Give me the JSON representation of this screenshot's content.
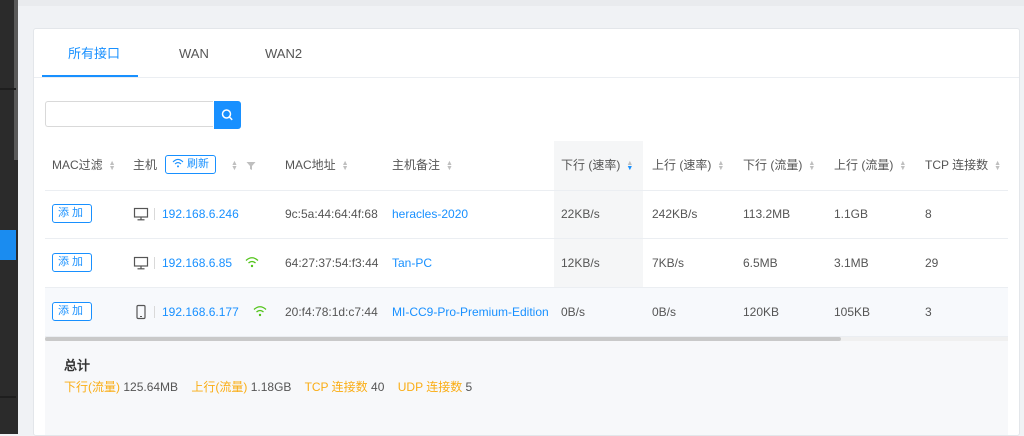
{
  "tabs": [
    {
      "label": "所有接口",
      "active": true
    },
    {
      "label": "WAN",
      "active": false
    },
    {
      "label": "WAN2",
      "active": false
    }
  ],
  "search": {
    "placeholder": "",
    "value": ""
  },
  "table": {
    "headers": {
      "mac_filter": "MAC过滤",
      "host": "主机",
      "refresh": "刷新",
      "mac": "MAC地址",
      "host_note": "主机备注",
      "down_rate": "下行 (速率)",
      "up_rate": "上行 (速率)",
      "down_traffic": "下行 (流量)",
      "up_traffic": "上行 (流量)",
      "tcp": "TCP 连接数"
    },
    "add_label": "添加",
    "rows": [
      {
        "device": "desktop-icon",
        "ip": "192.168.6.246",
        "wifi": false,
        "mac": "9c:5a:44:64:4f:68",
        "note": "heracles-2020",
        "down_rate": "22KB/s",
        "up_rate": "242KB/s",
        "down_traffic": "113.2MB",
        "up_traffic": "1.1GB",
        "tcp": "8"
      },
      {
        "device": "desktop-icon",
        "ip": "192.168.6.85",
        "wifi": true,
        "mac": "64:27:37:54:f3:44",
        "note": "Tan-PC",
        "down_rate": "12KB/s",
        "up_rate": "7KB/s",
        "down_traffic": "6.5MB",
        "up_traffic": "3.1MB",
        "tcp": "29"
      },
      {
        "device": "phone-icon",
        "ip": "192.168.6.177",
        "wifi": true,
        "mac": "20:f4:78:1d:c7:44",
        "note": "MI-CC9-Pro-Premium-Edition",
        "down_rate": "0B/s",
        "up_rate": "0B/s",
        "down_traffic": "120KB",
        "up_traffic": "105KB",
        "tcp": "3"
      }
    ]
  },
  "summary": {
    "title": "总计",
    "down_label": "下行(流量)",
    "down_value": "125.64MB",
    "up_label": "上行(流量)",
    "up_value": "1.18GB",
    "tcp_label": "TCP 连接数",
    "tcp_value": "40",
    "udp_label": "UDP 连接数",
    "udp_value": "5"
  },
  "colors": {
    "accent": "#1890ff",
    "summary_label": "#faad14",
    "wifi": "#52c41a"
  }
}
